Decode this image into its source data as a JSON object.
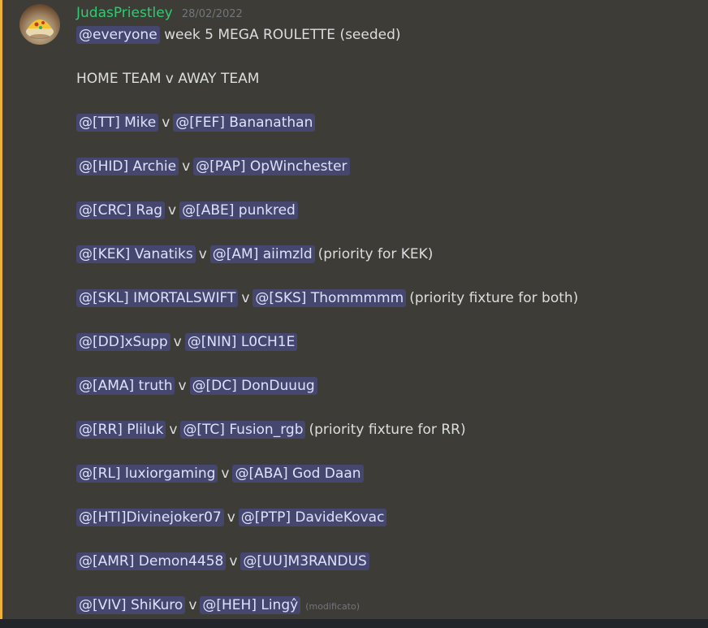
{
  "message": {
    "author": "JudasPriestley",
    "timestamp": "28/02/2022",
    "intro_mention": "@everyone",
    "intro_text": " week 5 MEGA ROULETTE (seeded)",
    "header_line": "HOME TEAM v AWAY TEAM",
    "versus": "v",
    "edited_label": "(modificato)",
    "fixtures": [
      {
        "home": "@[TT] Mike",
        "away": "@[FEF] Bananathan",
        "note": ""
      },
      {
        "home": "@[HID] Archie",
        "away": "@[PAP] OpWinchester",
        "note": ""
      },
      {
        "home": "@[CRC] Rag",
        "away": "@[ABE] punkred",
        "note": ""
      },
      {
        "home": "@[KEK] Vanatiks",
        "away": "@[AM] aiimzld",
        "note": "(priority for KEK)"
      },
      {
        "home": "@[SKL] IMORTALSWIFT",
        "away": "@[SKS] Thommmmm",
        "note": "(priority fixture for both)"
      },
      {
        "home": "@[DD]xSupp",
        "away": "@[NIN] L0CH1E",
        "note": ""
      },
      {
        "home": "@[AMA] truth",
        "away": "@[DC] DonDuuug",
        "note": ""
      },
      {
        "home": "@[RR] Pliluk",
        "away": "@[TC] Fusion_rgb",
        "note": "(priority fixture for RR)"
      },
      {
        "home": "@[RL] luxiorgaming",
        "away": "@[ABA] God Daan",
        "note": ""
      },
      {
        "home": "@[HTI]Divinejoker07",
        "away": "@[PTP] DavideKovac",
        "note": ""
      },
      {
        "home": "@[AMR] Demon4458",
        "away": "@[UU]M3RANDUS",
        "note": ""
      },
      {
        "home": "@[VIV] ShiKuro",
        "away": "@[HEH] Lingŷ",
        "note": ""
      }
    ]
  },
  "colors": {
    "message_bg": "#3d3c36",
    "highlight_border": "#f0b232",
    "username": "#2ecc71",
    "mention_text": "#dee0fc",
    "timestamp": "#72767d"
  },
  "icons": {
    "avatar": "pizza-avatar-icon"
  }
}
